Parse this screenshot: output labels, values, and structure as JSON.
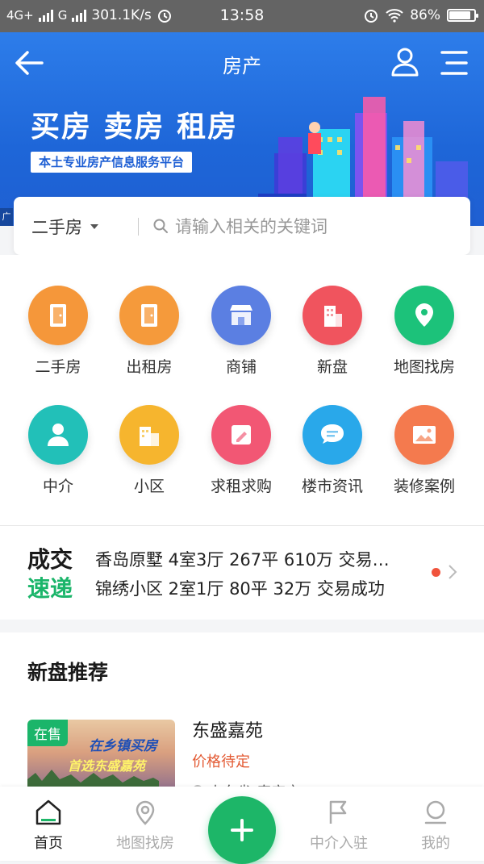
{
  "status_bar": {
    "network": "4G+",
    "network2": "G",
    "speed": "301.1K/s",
    "time": "13:58",
    "battery": "86%",
    "battery_level": 0.86
  },
  "header": {
    "title": "房产",
    "banner_headline": "买房 卖房 租房",
    "banner_tagline": "本土专业房产信息服务平台",
    "ad_label": "广"
  },
  "search": {
    "type_label": "二手房",
    "placeholder": "请输入相关的关键词"
  },
  "grid": [
    {
      "label": "二手房",
      "icon": "door-icon",
      "color": "#f5973a"
    },
    {
      "label": "出租房",
      "icon": "door-icon",
      "color": "#f59a3b"
    },
    {
      "label": "商铺",
      "icon": "store-icon",
      "color": "#5b7fe2"
    },
    {
      "label": "新盘",
      "icon": "building-icon",
      "color": "#f0545e"
    },
    {
      "label": "地图找房",
      "icon": "map-pin-icon",
      "color": "#1cc27a"
    },
    {
      "label": "中介",
      "icon": "person-icon",
      "color": "#22c0b8"
    },
    {
      "label": "小区",
      "icon": "buildings-icon",
      "color": "#f6b52e"
    },
    {
      "label": "求租求购",
      "icon": "edit-icon",
      "color": "#f25774"
    },
    {
      "label": "楼市资讯",
      "icon": "chat-icon",
      "color": "#29a8ea"
    },
    {
      "label": "装修案例",
      "icon": "image-icon",
      "color": "#f47a4e"
    }
  ],
  "deals": {
    "logo_line1": "成交",
    "logo_line2": "速递",
    "items": [
      "香岛原墅 4室3厅 267平 610万 交易…",
      "锦绣小区 2室1厅 80平 32万 交易成功"
    ]
  },
  "recommend": {
    "title": "新盘推荐",
    "item": {
      "badge": "在售",
      "slogan1": "在乡镇买房",
      "slogan2": "首选东盛嘉苑",
      "name": "东盛嘉苑",
      "price": "价格待定",
      "location": "山东省-泰安市"
    }
  },
  "tabbar": {
    "tabs": [
      {
        "label": "首页",
        "icon": "home-icon",
        "active": true
      },
      {
        "label": "地图找房",
        "icon": "map-pin-icon",
        "active": false
      },
      {
        "label": "中介入驻",
        "icon": "flag-icon",
        "active": false
      },
      {
        "label": "我的",
        "icon": "profile-icon",
        "active": false
      }
    ],
    "fab_icon": "plus-icon"
  },
  "colors": {
    "brand_blue": "#1f66d8",
    "accent_green": "#1db668",
    "price_orange": "#e35a33",
    "dot_red": "#f0533c"
  }
}
